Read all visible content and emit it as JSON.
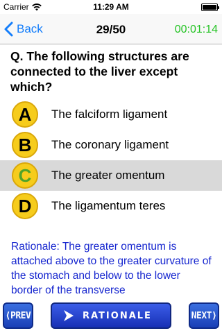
{
  "status_bar": {
    "carrier": "Carrier",
    "time": "11:29 AM",
    "wifi_icon": "wifi-icon",
    "battery_icon": "battery-icon"
  },
  "nav": {
    "back_label": "Back",
    "counter": "29/50",
    "timer": "00:01:14",
    "back_icon": "chevron-left-icon",
    "accent_color": "#147efb",
    "timer_color": "#22c322"
  },
  "question": {
    "text": "Q. The following structures are connected to the liver except which?"
  },
  "options": [
    {
      "letter": "A",
      "text": "The falciform ligament",
      "selected": false
    },
    {
      "letter": "B",
      "text": "The coronary ligament",
      "selected": false
    },
    {
      "letter": "C",
      "text": "The greater omentum",
      "selected": true
    },
    {
      "letter": "D",
      "text": "The ligamentum teres",
      "selected": false
    }
  ],
  "rationale": {
    "text": "Rationale: The greater omentum is attached above to the greater curvature of the stomach and below to the lower border of the transverse",
    "color": "#1626cf"
  },
  "bottom": {
    "prev_label": "⟨PREV",
    "rationale_label": "RATIONALE",
    "next_label": "NEXT⟩",
    "rationale_icon": "chevron-right-icon"
  }
}
